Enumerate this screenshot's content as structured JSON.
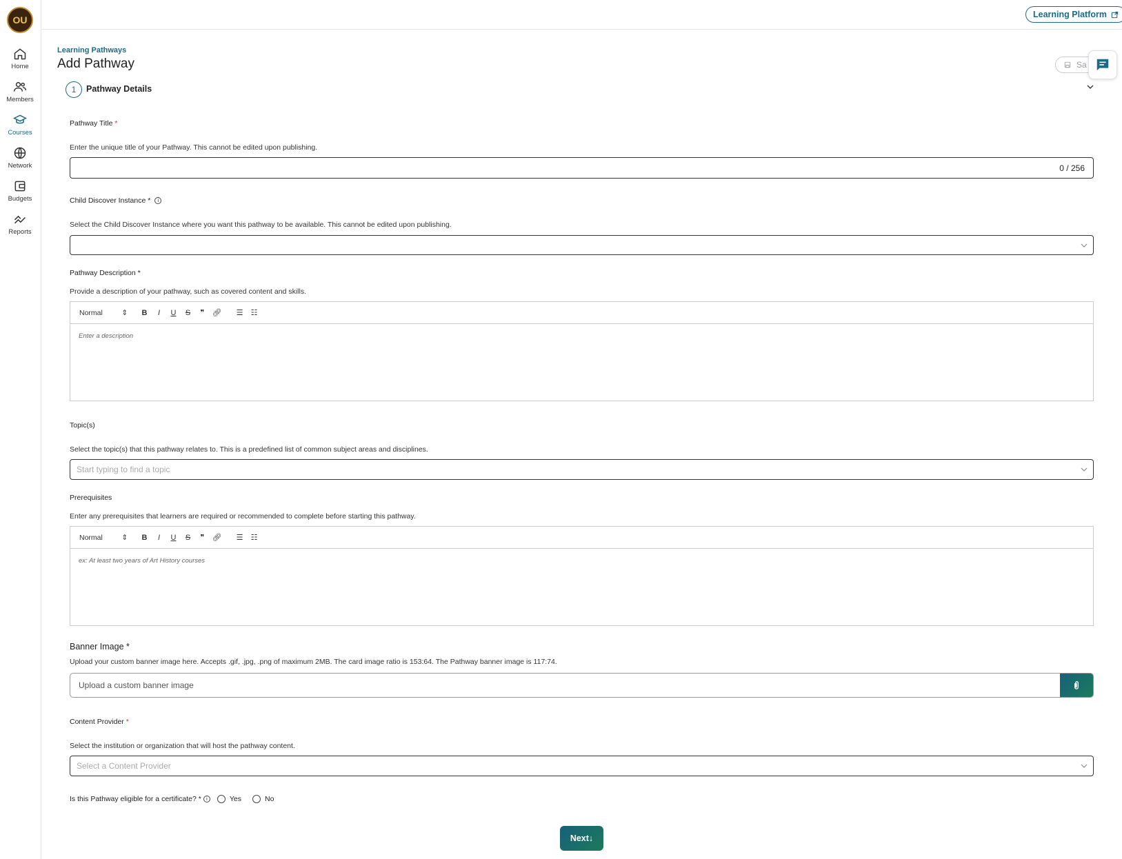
{
  "sidebar": {
    "logo_text": "OU",
    "items": [
      {
        "label": "Home",
        "icon": "home-icon"
      },
      {
        "label": "Members",
        "icon": "members-icon"
      },
      {
        "label": "Courses",
        "icon": "courses-icon",
        "active": true
      },
      {
        "label": "Network",
        "icon": "globe-icon"
      },
      {
        "label": "Budgets",
        "icon": "wallet-icon"
      },
      {
        "label": "Reports",
        "icon": "reports-icon"
      }
    ]
  },
  "header": {
    "learning_platform_label": "Learning Platform",
    "breadcrumb": "Learning Pathways",
    "page_title": "Add Pathway",
    "save_label": "Sa"
  },
  "step": {
    "number": "1",
    "title": "Pathway Details"
  },
  "form": {
    "pathway_title": {
      "label": "Pathway Title",
      "required": "*",
      "help": "Enter the unique title of your Pathway. This cannot be edited upon publishing.",
      "value": "",
      "counter": "0 / 256"
    },
    "child_instance": {
      "label": "Child Discover Instance *",
      "help": "Select the Child Discover Instance where you want this pathway to be available. This cannot be edited upon publishing."
    },
    "description": {
      "label": "Pathway Description *",
      "help": "Provide a description of your pathway, such as covered content and skills.",
      "format": "Normal",
      "placeholder": "Enter a description"
    },
    "topics": {
      "label": "Topic(s)",
      "help": "Select the topic(s) that this pathway relates to. This is a predefined list of common subject areas and disciplines.",
      "placeholder": "Start typing to find a topic"
    },
    "prerequisites": {
      "label": "Prerequisites",
      "help": "Enter any prerequisites that learners are required or recommended to complete before starting this pathway.",
      "format": "Normal",
      "placeholder": "ex: At least two years of Art History courses"
    },
    "banner": {
      "label": "Banner Image *",
      "help": "Upload your custom banner image here. Accepts .gif, .jpg, .png of maximum 2MB. The card image ratio is 153:64. The Pathway banner image is 117:74.",
      "placeholder": "Upload a custom banner image"
    },
    "content_provider": {
      "label": "Content Provider",
      "required": "*",
      "help": "Select the institution or organization that will host the pathway content.",
      "placeholder": "Select a Content Provider"
    },
    "certificate": {
      "question": "Is this Pathway eligible for a certificate? *",
      "yes": "Yes",
      "no": "No"
    }
  },
  "next_label": "Next",
  "colors": {
    "accent": "#1a6a8a",
    "required": "#d9342b",
    "button_gradient_start": "#17607a",
    "button_gradient_end": "#1d7a5a"
  }
}
